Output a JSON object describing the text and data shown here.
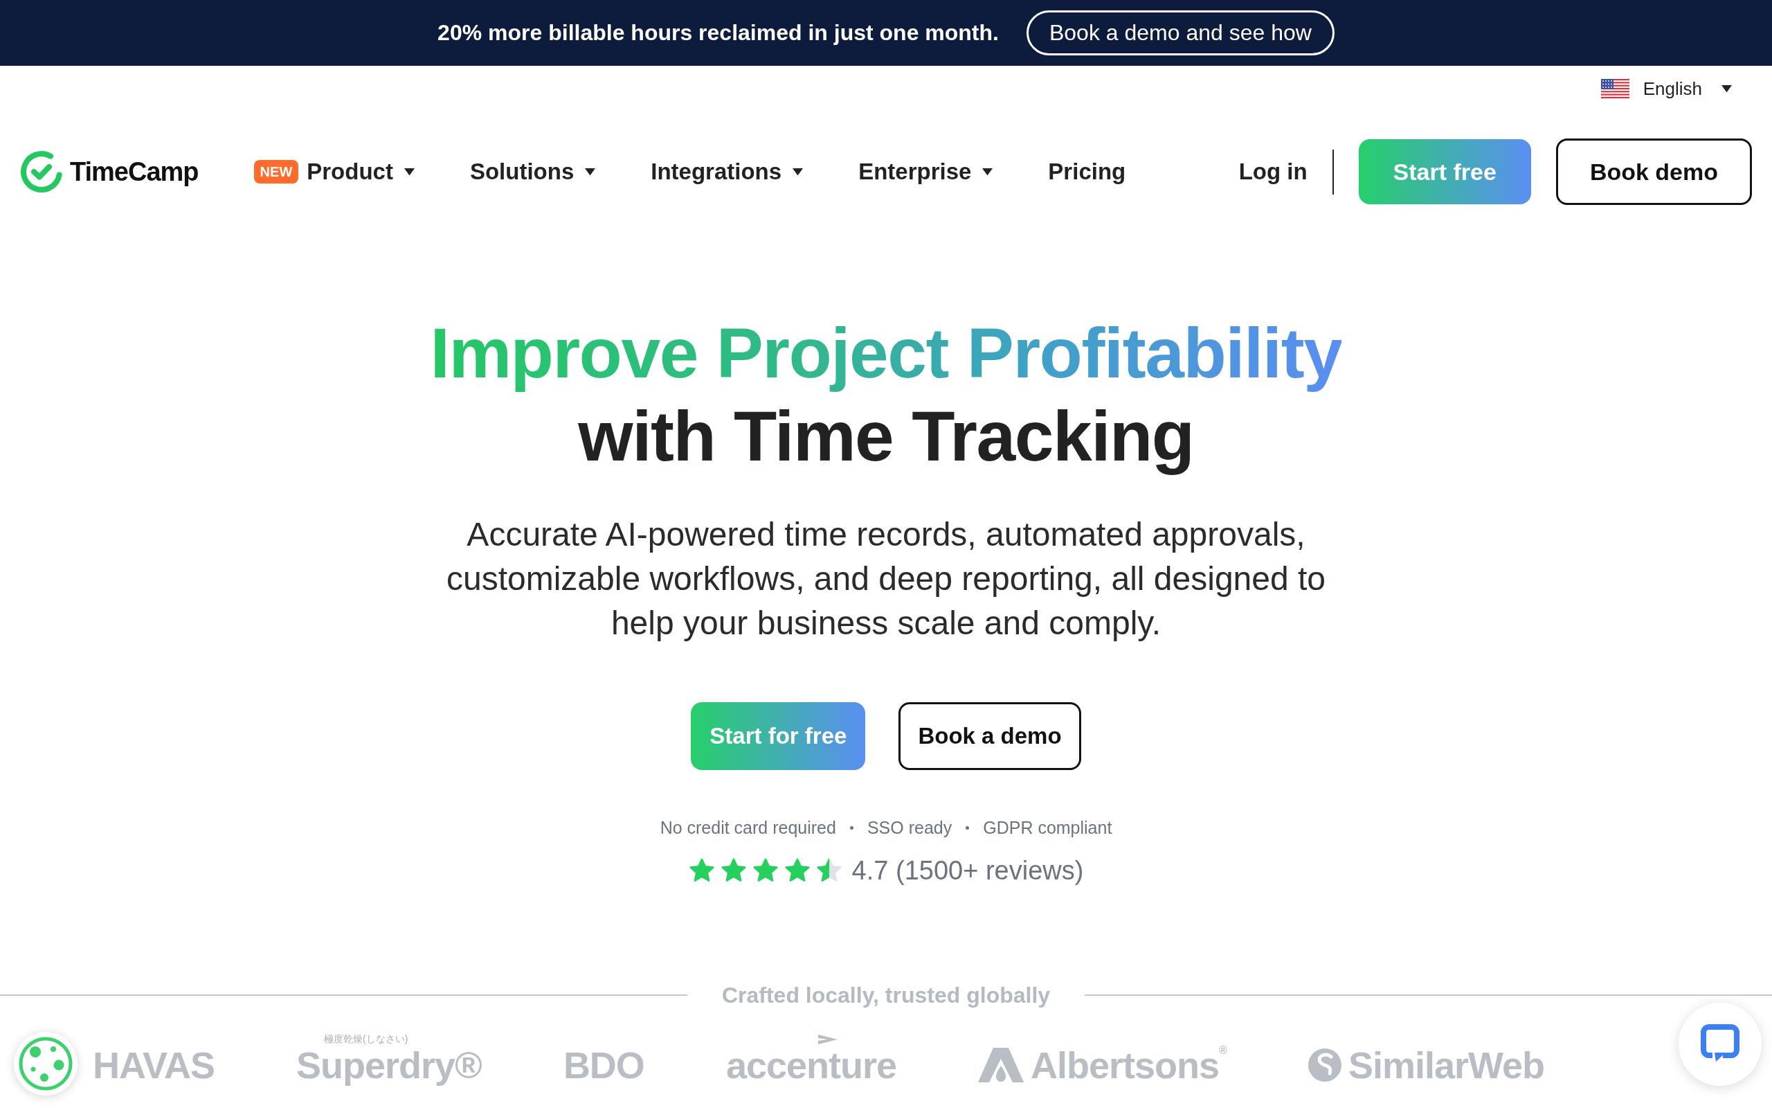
{
  "promo_banner": {
    "text": "20% more billable hours reclaimed in just one month.",
    "button": "Book a demo and see how"
  },
  "language_selector": {
    "label": "English"
  },
  "nav": {
    "brand": "TimeCamp",
    "items": [
      {
        "label": "Product",
        "badge": "NEW",
        "dropdown": true
      },
      {
        "label": "Solutions",
        "dropdown": true
      },
      {
        "label": "Integrations",
        "dropdown": true
      },
      {
        "label": "Enterprise",
        "dropdown": true
      },
      {
        "label": "Pricing",
        "dropdown": false
      }
    ],
    "login": "Log in",
    "primary_button": "Start free",
    "secondary_button": "Book demo"
  },
  "hero": {
    "title_highlight": "Improve Project Profitability",
    "title_rest": "with Time Tracking",
    "subtitle": "Accurate AI-powered time records, automated approvals, customizable workflows, and deep reporting, all designed to help your business scale and comply.",
    "primary_button": "Start for free",
    "secondary_button": "Book a demo",
    "trust_points": [
      "No credit card required",
      "SSO ready",
      "GDPR compliant"
    ],
    "rating": {
      "stars": 4.5,
      "text": "4.7 (1500+ reviews)"
    }
  },
  "clients": {
    "heading": "Crafted locally, trusted globally",
    "logos": [
      {
        "kind": "wordmark",
        "name": "HAVAS"
      },
      {
        "kind": "tagline",
        "name": "Superdry®",
        "tagline": "極度乾燥(しなさい)"
      },
      {
        "kind": "wordmark",
        "name": "BDO"
      },
      {
        "kind": "chevron",
        "name": "accenture"
      },
      {
        "kind": "peak",
        "name": "Albertsons$^{®}$"
      },
      {
        "kind": "swirl",
        "name": "SimilarWeb"
      }
    ]
  }
}
